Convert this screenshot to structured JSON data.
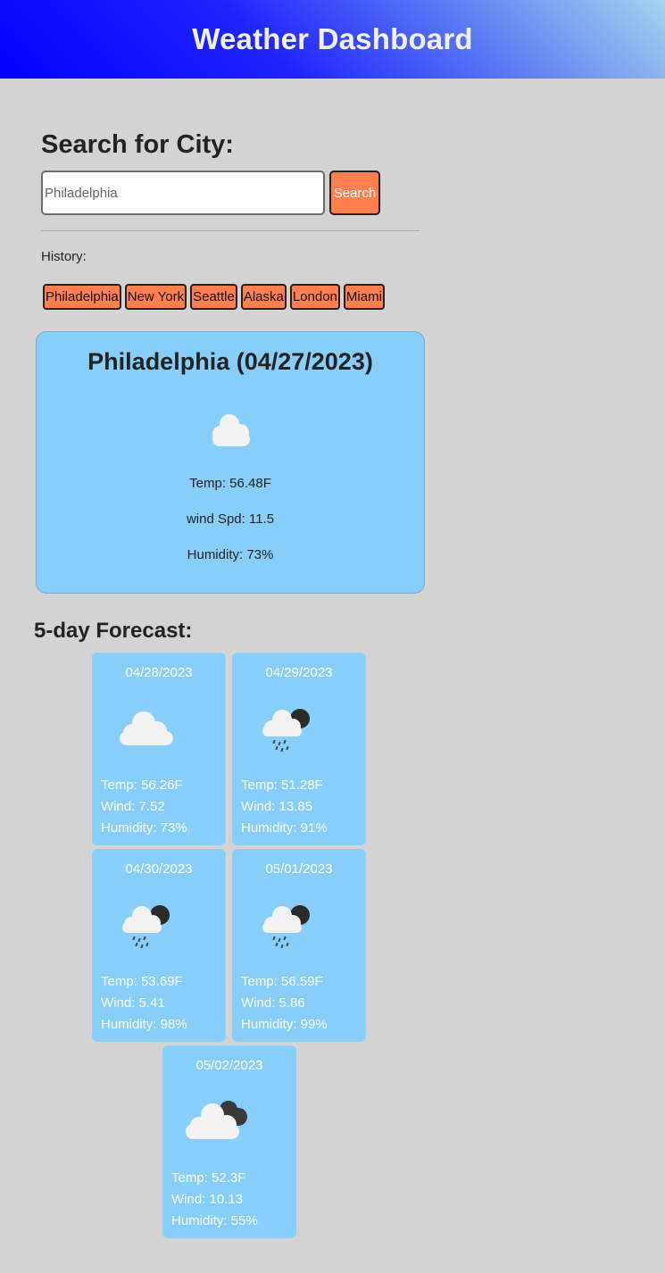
{
  "header": {
    "title": "Weather Dashboard"
  },
  "search": {
    "title": "Search for City:",
    "placeholder": "Philadelphia",
    "button_label": "Search"
  },
  "history": {
    "label": "History:",
    "cities": [
      "Philadelphia",
      "New York",
      "Seattle",
      "Alaska",
      "London",
      "Miami"
    ]
  },
  "current": {
    "title": "Philadelphia (04/27/2023)",
    "icon": "cloud-icon",
    "temp": "Temp: 56.48F",
    "wind": "wind Spd: 11.5",
    "humidity": "Humidity: 73%"
  },
  "forecast": {
    "title": "5-day Forecast:",
    "days": [
      {
        "date": "04/28/2023",
        "icon": "cloud-icon",
        "temp": "Temp: 56.26F",
        "wind": "Wind: 7.52",
        "humidity": "Humidity: 73%"
      },
      {
        "date": "04/29/2023",
        "icon": "rain-night-icon",
        "temp": "Temp: 51.28F",
        "wind": "Wind: 13.85",
        "humidity": "Humidity: 91%"
      },
      {
        "date": "04/30/2023",
        "icon": "rain-night-icon",
        "temp": "Temp: 53.69F",
        "wind": "Wind: 5.41",
        "humidity": "Humidity: 98%"
      },
      {
        "date": "05/01/2023",
        "icon": "rain-night-icon",
        "temp": "Temp: 56.59F",
        "wind": "Wind: 5.86",
        "humidity": "Humidity: 99%"
      },
      {
        "date": "05/02/2023",
        "icon": "broken-clouds-icon",
        "temp": "Temp: 52.3F",
        "wind": "Wind: 10.13",
        "humidity": "Humidity: 55%"
      }
    ]
  },
  "colors": {
    "accent_button": "#ff7f4f",
    "card_background": "#87cefa",
    "page_background": "#d3d3d3",
    "header_gradient": [
      "#0000ff",
      "#a7d3ee"
    ]
  }
}
